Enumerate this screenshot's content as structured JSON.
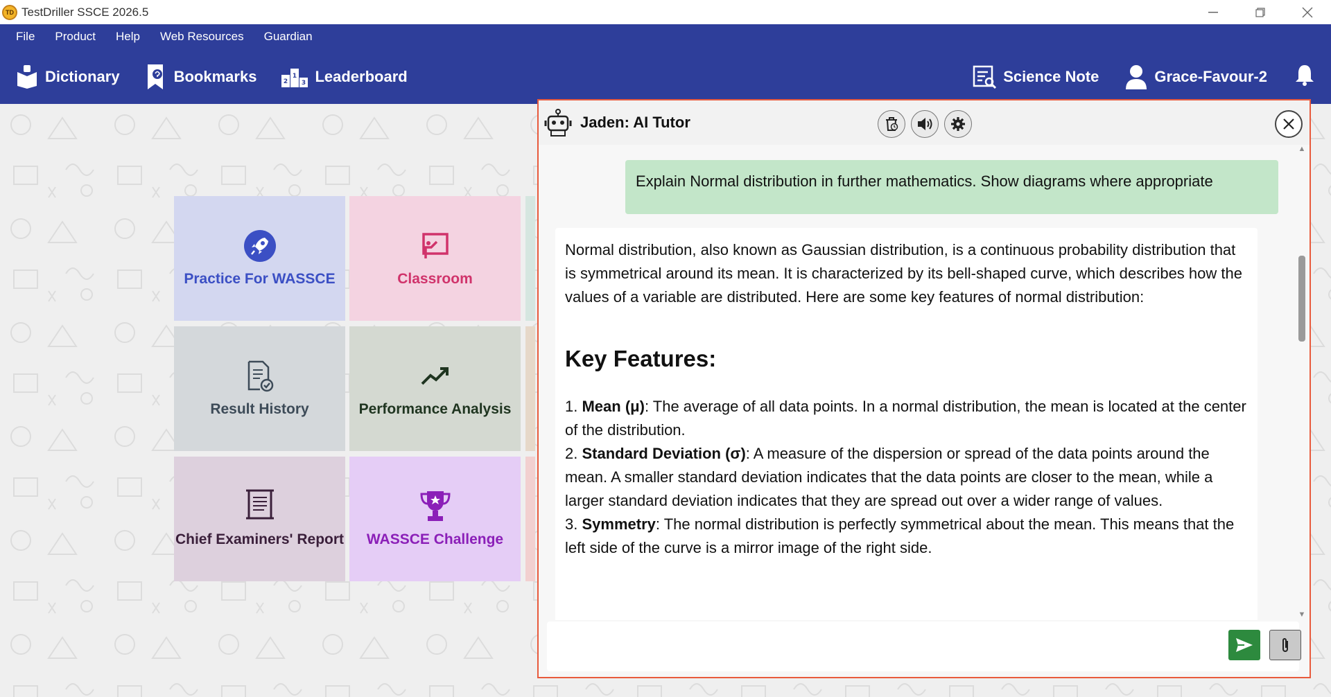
{
  "window": {
    "title": "TestDriller SSCE 2026.5",
    "icon_text": "TD"
  },
  "menu": [
    "File",
    "Product",
    "Help",
    "Web Resources",
    "Guardian"
  ],
  "toolbar": {
    "dictionary": "Dictionary",
    "bookmarks": "Bookmarks",
    "leaderboard": "Leaderboard",
    "science_note": "Science Note",
    "user": "Grace-Favour-2"
  },
  "tiles": [
    {
      "label": "Practice For WASSCE",
      "icon": "rocket-icon",
      "bg": "#d3d7f0",
      "color": "#3b4fc4"
    },
    {
      "label": "Classroom",
      "icon": "classroom-icon",
      "bg": "#f4d3e1",
      "color": "#d0336b"
    },
    {
      "label": "Result History",
      "icon": "document-check-icon",
      "bg": "#d4d8db",
      "color": "#3d4b58"
    },
    {
      "label": "Performance Analysis",
      "icon": "trend-up-icon",
      "bg": "#d4d9d1",
      "color": "#1f3520"
    },
    {
      "label": "Chief Examiners' Report",
      "icon": "scroll-icon",
      "bg": "#ddd0dd",
      "color": "#3a1f3a"
    },
    {
      "label": "WASSCE Challenge",
      "icon": "trophy-icon",
      "bg": "#e5cdf6",
      "color": "#8b1fb8"
    }
  ],
  "tutor": {
    "title": "Jaden: AI Tutor",
    "user_message": "Explain Normal distribution in further mathematics. Show diagrams where appropriate",
    "bot_intro": "Normal distribution, also known as Gaussian distribution, is a continuous probability distribution that is symmetrical around its mean. It is characterized by its bell-shaped curve, which describes how the values of a variable are distributed. Here are some key features of normal distribution:",
    "heading": "Key Features:",
    "features": [
      {
        "num": "1.",
        "term": "Mean (μ)",
        "text": ": The average of all data points. In a normal distribution, the mean is located at the center of the distribution."
      },
      {
        "num": "2.",
        "term": "Standard Deviation (σ)",
        "text": ": A measure of the dispersion or spread of the data points around the mean. A smaller standard deviation indicates that the data points are closer to the mean, while a larger standard deviation indicates that they are spread out over a wider range of values."
      },
      {
        "num": "3.",
        "term": "Symmetry",
        "text": ": The normal distribution is perfectly symmetrical about the mean. This means that the left side of the curve is a mirror image of the right side."
      }
    ],
    "input_placeholder": ""
  },
  "colors": {
    "brand": "#2e3e9a",
    "panel_border": "#e85a3c",
    "user_bubble": "#c3e6c9",
    "send": "#2d8a3e"
  }
}
